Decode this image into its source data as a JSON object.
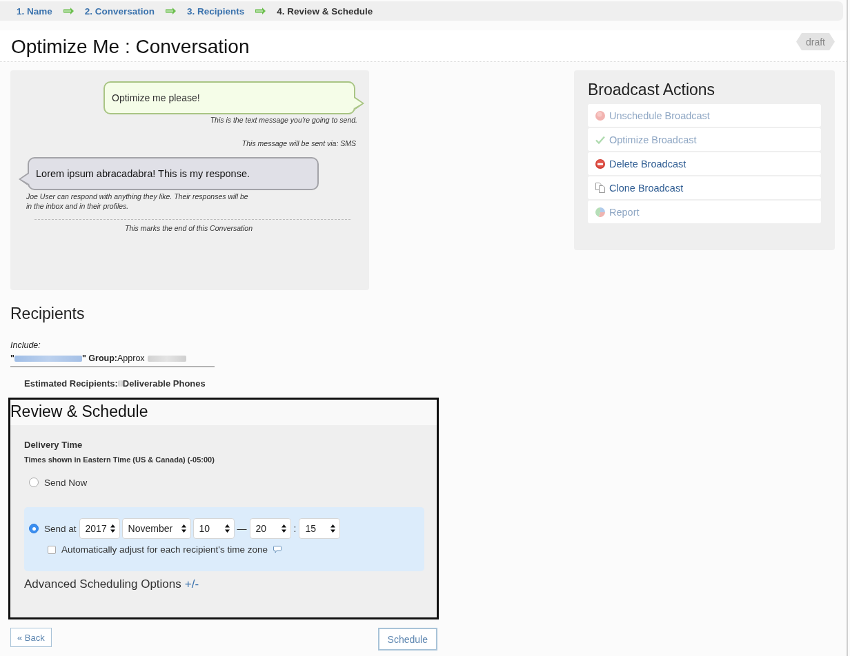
{
  "steps": [
    {
      "label": "1. Name",
      "selected": false
    },
    {
      "label": "2. Conversation",
      "selected": false
    },
    {
      "label": "3. Recipients",
      "selected": false
    },
    {
      "label": "4. Review & Schedule",
      "selected": true
    }
  ],
  "page": {
    "title": "Optimize Me : Conversation",
    "status_tag": "draft"
  },
  "conversation": {
    "outgoing": {
      "text": "Optimize me please!",
      "caption": "This is the text message you're going to send."
    },
    "channel_note": "This message will be sent via: SMS",
    "reply": {
      "text": "Lorem ipsum abracadabra! This is my response.",
      "caption": "Joe User can respond with anything they like. Their responses will be in the inbox and in their profiles."
    },
    "end_note": "This marks the end of this Conversation"
  },
  "broadcast_actions": {
    "title": "Broadcast Actions",
    "items": [
      {
        "kind": "unschedule",
        "label": "Unschedule Broadcast",
        "disabled": true
      },
      {
        "kind": "optimize",
        "label": "Optimize Broadcast",
        "disabled": true
      },
      {
        "kind": "delete",
        "label": "Delete Broadcast",
        "disabled": false
      },
      {
        "kind": "clone",
        "label": "Clone Broadcast",
        "disabled": false
      },
      {
        "kind": "report",
        "label": "Report",
        "disabled": true
      }
    ]
  },
  "recipients": {
    "title": "Recipients",
    "include_label": "Include:",
    "group": {
      "open_quote": "\"",
      "type_label": "\" Group:",
      "count_label": "Approx"
    },
    "estimate": {
      "label": "Estimated Recipients:",
      "unit": "Deliverable Phones"
    }
  },
  "review": {
    "title": "Review & Schedule",
    "delivery_title": "Delivery Time",
    "timezone_note": "Times shown in Eastern Time (US & Canada) (-05:00)",
    "options": [
      {
        "kind": "now",
        "label": "Send Now",
        "selected": false
      },
      {
        "kind": "at",
        "label": "Send at",
        "selected": true,
        "fields": [
          {
            "kind": "year",
            "value": "2017"
          },
          {
            "kind": "month",
            "value": "November"
          },
          {
            "kind": "day",
            "value": "10"
          },
          {
            "kind": "separator",
            "value": "—"
          },
          {
            "kind": "hour",
            "value": "20"
          },
          {
            "kind": "separator",
            "value": ":"
          },
          {
            "kind": "minute",
            "value": "15"
          }
        ],
        "timezone_adjust": {
          "label": "Automatically adjust for each recipient's time zone",
          "checked": false
        }
      }
    ],
    "advanced": {
      "label": "Advanced Scheduling Options",
      "toggle": "+/-"
    }
  },
  "buttons": {
    "back": "« Back",
    "schedule": "Schedule"
  }
}
